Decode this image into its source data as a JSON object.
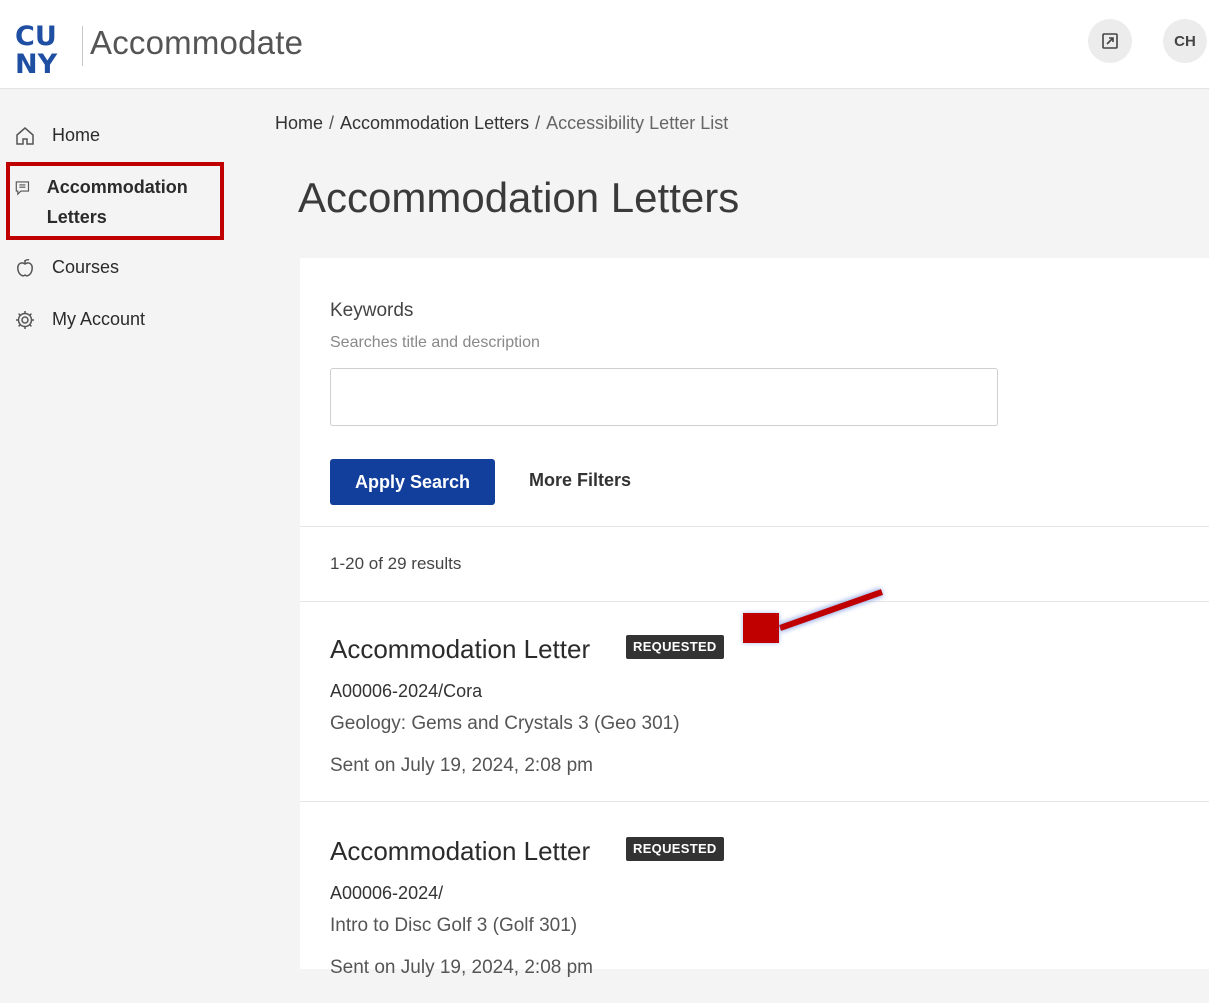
{
  "header": {
    "logo_text": "CUNY",
    "app_title": "Accommodate",
    "avatar_initials": "CH",
    "expand_icon": "expand-icon"
  },
  "sidebar": {
    "items": [
      {
        "label": "Home",
        "icon": "home-icon"
      },
      {
        "label": "Accommodation Letters",
        "icon": "letters-icon",
        "active": true
      },
      {
        "label": "Courses",
        "icon": "apple-icon"
      },
      {
        "label": "My Account",
        "icon": "gear-icon"
      }
    ]
  },
  "breadcrumb": {
    "items": [
      "Home",
      "Accommodation Letters",
      "Accessibility Letter List"
    ],
    "separator": "/"
  },
  "page_title": "Accommodation Letters",
  "search": {
    "label": "Keywords",
    "help": "Searches title and description",
    "value": "",
    "apply_label": "Apply Search",
    "more_filters_label": "More Filters"
  },
  "results": {
    "count_text": "1-20 of 29 results",
    "items": [
      {
        "title": "Accommodation Letter",
        "status": "REQUESTED",
        "id": "A00006-2024/Cora",
        "course": "Geology: Gems and Crystals 3 (Geo 301)",
        "sent": "Sent on July 19, 2024, 2:08 pm"
      },
      {
        "title": "Accommodation Letter",
        "status": "REQUESTED",
        "id": "A00006-2024/",
        "course": "Intro to Disc Golf 3 (Golf 301)",
        "sent": "Sent on July 19, 2024, 2:08 pm"
      }
    ]
  },
  "colors": {
    "primary": "#123e9c",
    "annotation": "#c00000",
    "badge": "#333333"
  }
}
